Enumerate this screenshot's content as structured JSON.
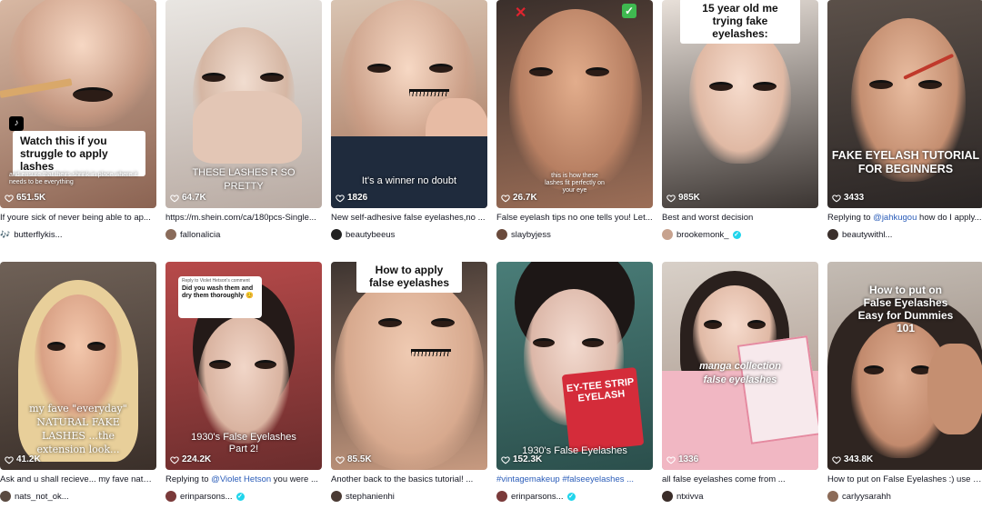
{
  "colors": {
    "link": "#2b5db9",
    "verified": "#20d5ec",
    "text": "#161823"
  },
  "cards": [
    {
      "views": "651.5K",
      "overlay_box": "Watch this if you struggle to apply lashes",
      "overlay_small": "and ensure that theirs shrink in place where it needs to be everything",
      "desc": "If youre sick of never being able to ap...",
      "author": "butterflykis...",
      "author_icon": "music-note"
    },
    {
      "views": "64.7K",
      "overlay_big": "THESE LASHES R SO PRETTY",
      "desc": "https://m.shein.com/ca/180pcs-Single...",
      "author": "fallonalicia"
    },
    {
      "views": "1826",
      "overlay_caption": "It's a winner no doubt",
      "desc": "New self-adhesive false eyelashes,no ...",
      "author": "beautybeeus"
    },
    {
      "views": "26.7K",
      "overlay_small": "this is how these lashes fit perfectly on your eye",
      "mark_left": "✕",
      "mark_right": "✓",
      "desc": "False eyelash tips no one tells you! Let...",
      "author": "slaybyjess"
    },
    {
      "views": "985K",
      "overlay_box": "15 year old me trying fake eyelashes:",
      "desc": "Best and worst decision",
      "author": "brookemonk_",
      "verified": true
    },
    {
      "views": "3433",
      "overlay_big": "FAKE EYELASH TUTORIAL FOR BEGINNERS",
      "desc_prefix": "Replying to ",
      "desc_mention": "@jahkugou",
      "desc_suffix": " how do I apply...",
      "author": "beautywithl..."
    },
    {
      "views": "41.2K",
      "overlay_caption": "my fave \"everyday\" NATURAL FAKE LASHES ...the extension look...",
      "desc": "Ask and u shall recieve... my fave natur...",
      "author": "nats_not_ok..."
    },
    {
      "views": "224.2K",
      "reply_header": "Reply to Violet Hetson's comment",
      "overlay_box": "Did you wash them and dry them thoroughly 😊",
      "overlay_caption": "1930's False Eyelashes Part 2!",
      "desc_prefix": "Replying to ",
      "desc_mention": "@Violet Hetson",
      "desc_suffix": " you were ...",
      "author": "erinparsons...",
      "verified": true
    },
    {
      "views": "85.5K",
      "overlay_box": "How to apply false eyelashes",
      "desc": "Another back to the basics tutorial! ...",
      "author": "stephanienhi"
    },
    {
      "views": "152.3K",
      "overlay_caption": "1930's False Eyelashes",
      "package_text": "EY-TEE STRIP EYELASH",
      "desc_mention": "#vintagemakeup #falseeyelashes ...",
      "author": "erinparsons...",
      "verified": true
    },
    {
      "views": "1336",
      "overlay_caption": "manga collection false eyelashes",
      "desc": "all false eyelashes come from ...",
      "author": "ntxivva"
    },
    {
      "views": "343.8K",
      "overlay_big": "How to put on False Eyelashes Easy for Dummies 101",
      "desc": "How to put on False Eyelashes :) use c...",
      "author": "carlyysarahh"
    }
  ]
}
